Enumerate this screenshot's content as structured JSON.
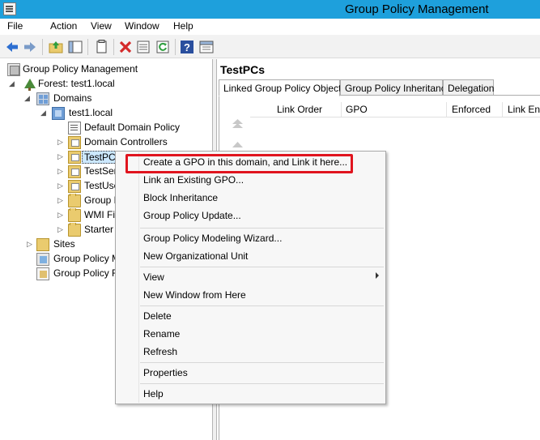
{
  "window": {
    "title": "Group Policy Management",
    "app_icon": "gpmc-window-icon"
  },
  "menu": [
    "File",
    "Action",
    "View",
    "Window",
    "Help"
  ],
  "toolbar": {
    "buttons": [
      "back-arrow-icon",
      "forward-arrow-icon",
      "up-folder-icon",
      "show-hide-tree-icon",
      "copy-icon",
      "delete-icon",
      "properties-icon",
      "refresh-icon",
      "help-icon",
      "export-list-icon"
    ],
    "colors": {
      "nav_blue": "#2d6fd1",
      "delete_red": "#d42a2a",
      "refresh_green": "#2f9e3f",
      "help_blue": "#2a4f9e"
    }
  },
  "tree": {
    "root": "Group Policy Management",
    "forest": "Forest: test1.local",
    "domains": "Domains",
    "domain": "test1.local",
    "children": [
      "Default Domain Policy",
      "Domain Controllers",
      "TestPCs",
      "TestSer",
      "TestUse",
      "Group P",
      "WMI Fi",
      "Starter"
    ],
    "sites": "Sites",
    "modeling": "Group Policy M",
    "results": "Group Policy R"
  },
  "right_pane": {
    "title": "TestPCs",
    "tabs": [
      "Linked Group Policy Objects",
      "Group Policy Inheritance",
      "Delegation"
    ],
    "columns": [
      "Link Order",
      "GPO",
      "Enforced",
      "Link Ena"
    ]
  },
  "context_menu": {
    "items": [
      "Create a GPO in this domain, and Link it here...",
      "Link an Existing GPO...",
      "Block Inheritance",
      "Group Policy Update...",
      "Group Policy Modeling Wizard...",
      "New Organizational Unit",
      "View",
      "New Window from Here",
      "Delete",
      "Rename",
      "Refresh",
      "Properties",
      "Help"
    ],
    "highlight_color": "#e0141e"
  }
}
